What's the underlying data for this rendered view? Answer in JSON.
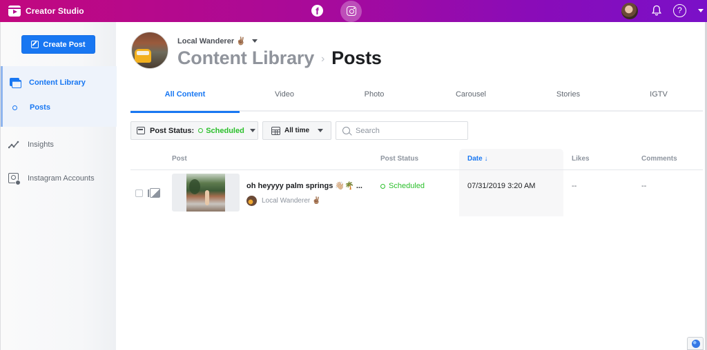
{
  "app": {
    "title": "Creator Studio",
    "icons": {
      "brand": "clapperboard-play-icon",
      "facebook": "facebook-icon",
      "instagram": "instagram-icon",
      "notifications": "bell-icon",
      "help": "help-icon",
      "account_menu": "caret-down-icon"
    },
    "help_glyph": "?",
    "fb_glyph": "f",
    "accent": "#1877f2",
    "header_gradient": [
      "#c2087f",
      "#7a10c8"
    ]
  },
  "sidebar": {
    "create_button": "Create Post",
    "items": [
      {
        "label": "Content Library",
        "icon": "content-library-icon",
        "active": true
      },
      {
        "label": "Posts",
        "icon": "dot-icon",
        "active": true,
        "sub": true
      },
      {
        "label": "Insights",
        "icon": "insights-chart-icon",
        "active": false
      },
      {
        "label": "Instagram Accounts",
        "icon": "account-settings-icon",
        "active": false
      }
    ]
  },
  "header": {
    "account_name": "Local Wanderer ✌🏽",
    "breadcrumb": {
      "parent": "Content Library",
      "separator": "›",
      "current": "Posts"
    }
  },
  "tabs": [
    {
      "label": "All Content",
      "active": true
    },
    {
      "label": "Video"
    },
    {
      "label": "Photo"
    },
    {
      "label": "Carousel"
    },
    {
      "label": "Stories"
    },
    {
      "label": "IGTV"
    }
  ],
  "filters": {
    "status_label": "Post Status:",
    "status_value": "Scheduled",
    "time_value": "All time",
    "search_placeholder": "Search",
    "search_value": ""
  },
  "table": {
    "columns": [
      "Post",
      "Post Status",
      "Date ↓",
      "Likes",
      "Comments"
    ],
    "sorted_column": "Date",
    "rows": [
      {
        "title": "oh heyyyy palm springs 👋🏼🌴 ...",
        "author": "Local Wanderer ✌🏽",
        "status": "Scheduled",
        "date": "07/31/2019 3:20 AM",
        "likes": "--",
        "comments": "--"
      }
    ]
  },
  "status_color": "#2abf2a"
}
